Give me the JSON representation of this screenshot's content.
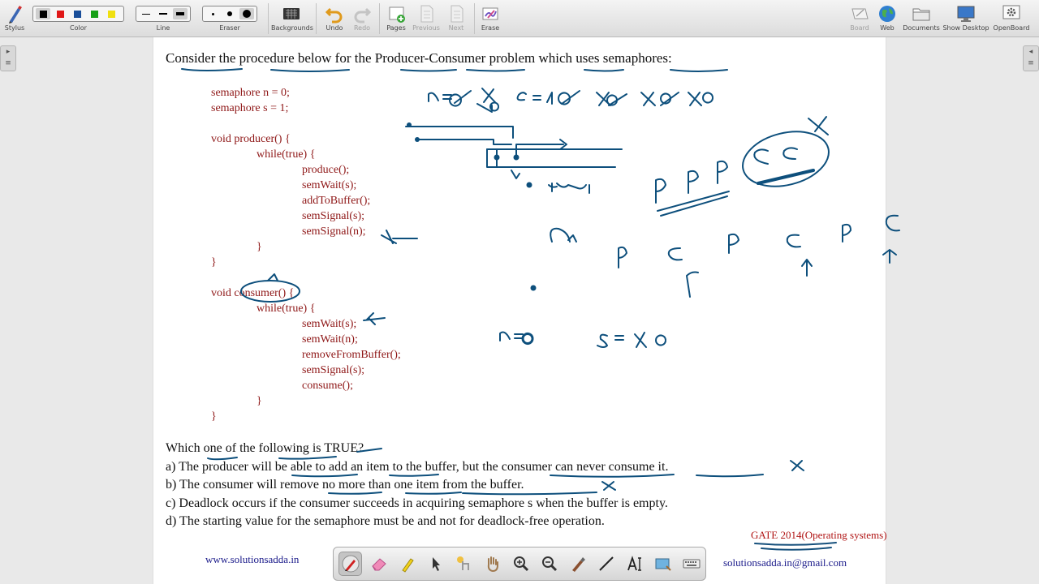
{
  "toolbar": {
    "stylus": "Stylus",
    "color": "Color",
    "line": "Line",
    "eraser": "Eraser",
    "backgrounds": "Backgrounds",
    "undo": "Undo",
    "redo": "Redo",
    "pages": "Pages",
    "previous": "Previous",
    "next": "Next",
    "erase": "Erase",
    "board": "Board",
    "web": "Web",
    "documents": "Documents",
    "show_desktop": "Show Desktop",
    "openboard": "OpenBoard",
    "colors": [
      "#000000",
      "#e01818",
      "#1a4f9a",
      "#18a018",
      "#f0e010"
    ]
  },
  "question": {
    "title": "Consider the procedure below for the Producer-Consumer problem which uses semaphores:",
    "code": [
      "semaphore n = 0;",
      "semaphore s = 1;",
      "void producer() {",
      "while(true) {",
      "produce();",
      "semWait(s);",
      "addToBuffer();",
      "semSignal(s);",
      "semSignal(n);",
      "}",
      "}",
      "void consumer() {",
      "while(true) {",
      "semWait(s);",
      "semWait(n);",
      "removeFromBuffer();",
      "semSignal(s);",
      "consume();",
      "}",
      "}"
    ],
    "prompt": "Which one of the following is TRUE?",
    "options": [
      "a) The producer will be able to add an item to the buffer, but the consumer can never consume it.",
      "b) The consumer will remove no more than one item from the buffer.",
      "c) Deadlock occurs if the consumer succeeds in acquiring semaphore s when the buffer is empty.",
      "d) The starting value for the semaphore must be and not for deadlock-free operation."
    ]
  },
  "footer": {
    "website": "www.solutionsadda.in",
    "email": "solutionsadda.in@gmail.com",
    "gate_tag": "GATE 2014(Operating systems)"
  },
  "ink_color": "#0d4f7c",
  "annotation_color": "#16507c",
  "tag_color": "#b01515",
  "dock": {
    "tools": [
      "pen-icon",
      "eraser-icon",
      "highlighter-icon",
      "pointer-icon",
      "laser-pointer-icon",
      "hand-icon",
      "zoom-in-icon",
      "zoom-out-icon",
      "capture-icon",
      "line-icon",
      "text-icon",
      "screenshot-icon",
      "keyboard-icon"
    ],
    "active_tool": "pen-icon"
  }
}
